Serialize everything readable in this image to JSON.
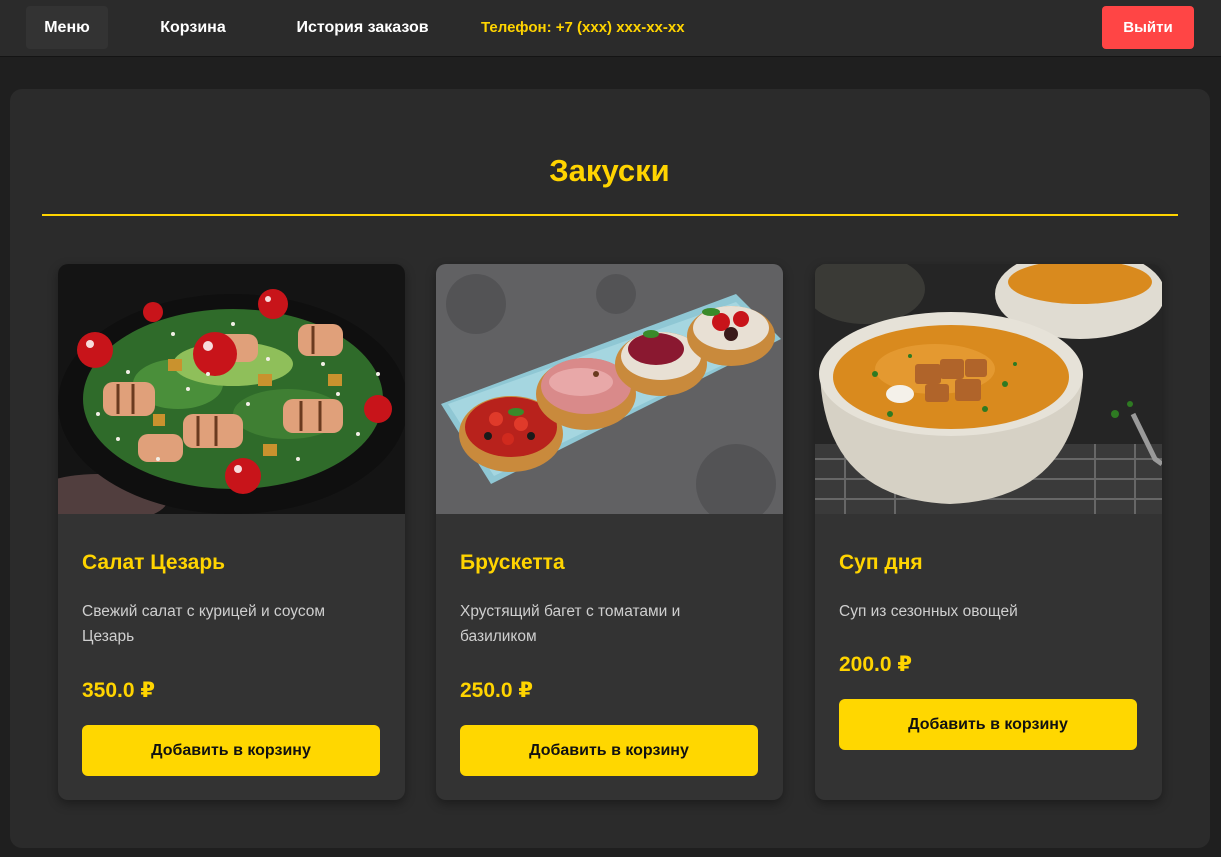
{
  "nav": {
    "menu": "Меню",
    "cart": "Корзина",
    "history": "История заказов",
    "phone": "Телефон: +7 (xxx) xxx-xx-xx",
    "logout": "Выйти"
  },
  "section": {
    "title": "Закуски"
  },
  "products": [
    {
      "image": "caesar-salad-photo",
      "title": "Салат Цезарь",
      "description": "Свежий салат с курицей и соусом Цезарь",
      "price": "350.0 ₽",
      "button": "Добавить в корзину"
    },
    {
      "image": "bruschetta-photo",
      "title": "Брускетта",
      "description": "Хрустящий багет с томатами и базиликом",
      "price": "250.0 ₽",
      "button": "Добавить в корзину"
    },
    {
      "image": "soup-photo",
      "title": "Суп дня",
      "description": "Суп из сезонных овощей",
      "price": "200.0 ₽",
      "button": "Добавить в корзину"
    }
  ],
  "colors": {
    "accent": "#ffd400",
    "logout": "#ff4545",
    "background": "#1f1f1f",
    "panel": "#2b2b2b",
    "card": "#333333"
  }
}
